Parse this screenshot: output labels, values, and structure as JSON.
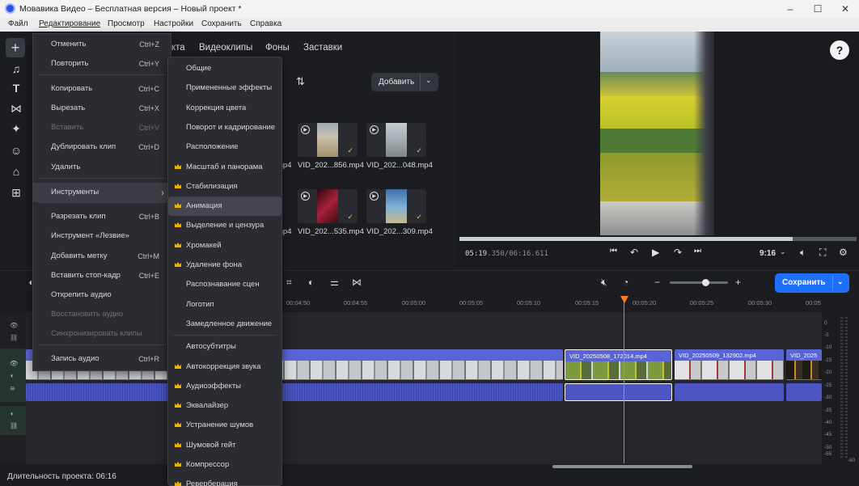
{
  "window": {
    "title": "Мовавика Видео – Бесплатная версия – Новый проект *",
    "minimize": "–",
    "maximize": "☐",
    "close": "✕"
  },
  "menubar": [
    "Файл",
    "Редактирование",
    "Просмотр",
    "Настройки",
    "Сохранить",
    "Справка"
  ],
  "library": {
    "tabs": [
      "Видеоклипы",
      "Фоны",
      "Заставки"
    ],
    "tab_partial": "кта",
    "add_label": "Добавить",
    "thumbs": [
      {
        "name": "VID_202...856.mp4",
        "color": "#a79a7c"
      },
      {
        "name": "VID_202...048.mp4",
        "color": "#8f9798"
      },
      {
        "name": "VID_202...535.mp4",
        "color": "#6a1a24"
      },
      {
        "name": "VID_202...309.mp4",
        "color": "#4a7fae"
      }
    ],
    "partial_names": [
      "mp4",
      "mp4"
    ]
  },
  "preview": {
    "help": "?",
    "timecode_current": "05:19",
    "timecode_ms": ".350",
    "timecode_total": "/06:16.611",
    "aspect": "9:16",
    "progress": 0.84
  },
  "toolbar": {
    "save_label": "Сохранить"
  },
  "ruler": [
    "00:04:50",
    "00:04:55",
    "00:05:00",
    "00:05:05",
    "00:05:10",
    "00:05:15",
    "00:05:20",
    "00:05:25",
    "00:05:30",
    "00:05"
  ],
  "clips": {
    "c1": "VID_20250508_172014.mp4",
    "c2": "VID_20250509_132902.mp4",
    "c3": "VID_2025"
  },
  "meter": [
    "0",
    "-5",
    "-10",
    "-15",
    "-20",
    "-25",
    "-30",
    "-35",
    "-40",
    "-45",
    "-50",
    "-55",
    "-60"
  ],
  "status": "Длительность проекта: 06:16",
  "edit_menu": [
    {
      "label": "Отменить",
      "shortcut": "Ctrl+Z",
      "disabled": false
    },
    {
      "label": "Повторить",
      "shortcut": "Ctrl+Y",
      "disabled": false
    },
    {
      "label": "Копировать",
      "shortcut": "Ctrl+C",
      "disabled": false
    },
    {
      "label": "Вырезать",
      "shortcut": "Ctrl+X",
      "disabled": false
    },
    {
      "label": "Вставить",
      "shortcut": "Ctrl+V",
      "disabled": true
    },
    {
      "label": "Дублировать клип",
      "shortcut": "Ctrl+D",
      "disabled": false
    },
    {
      "label": "Удалить",
      "shortcut": "",
      "disabled": false
    },
    {
      "label": "Инструменты",
      "shortcut": "›",
      "disabled": false
    },
    {
      "label": "Разрезать клип",
      "shortcut": "Ctrl+B",
      "disabled": false
    },
    {
      "label": "Инструмент «Лезвие»",
      "shortcut": "",
      "disabled": false
    },
    {
      "label": "Добавить метку",
      "shortcut": "Ctrl+M",
      "disabled": false
    },
    {
      "label": "Вставить стоп-кадр",
      "shortcut": "Ctrl+E",
      "disabled": false
    },
    {
      "label": "Открепить аудио",
      "shortcut": "",
      "disabled": false
    },
    {
      "label": "Восстановить аудио",
      "shortcut": "",
      "disabled": true
    },
    {
      "label": "Синхронизировать клипы",
      "shortcut": "",
      "disabled": true
    },
    {
      "label": "Запись аудио",
      "shortcut": "Ctrl+R",
      "disabled": false
    }
  ],
  "tools_menu": [
    {
      "label": "Общие",
      "premium": false
    },
    {
      "label": "Примененные эффекты",
      "premium": false
    },
    {
      "label": "Коррекция цвета",
      "premium": false
    },
    {
      "label": "Поворот и кадрирование",
      "premium": false
    },
    {
      "label": "Расположение",
      "premium": false
    },
    {
      "label": "Масштаб и панорама",
      "premium": true
    },
    {
      "label": "Стабилизация",
      "premium": true
    },
    {
      "label": "Анимация",
      "premium": true
    },
    {
      "label": "Выделение и цензура",
      "premium": true
    },
    {
      "label": "Хромакей",
      "premium": true
    },
    {
      "label": "Удаление фона",
      "premium": true
    },
    {
      "label": "Распознавание сцен",
      "premium": false
    },
    {
      "label": "Логотип",
      "premium": false
    },
    {
      "label": "Замедленное движение",
      "premium": false
    },
    {
      "label": "Автосубтитры",
      "premium": false
    },
    {
      "label": "Автокоррекция звука",
      "premium": true
    },
    {
      "label": "Аудиоэффекты",
      "premium": true
    },
    {
      "label": "Эквалайзер",
      "premium": true
    },
    {
      "label": "Устранение шумов",
      "premium": true
    },
    {
      "label": "Шумовой гейт",
      "premium": true
    },
    {
      "label": "Компрессор",
      "premium": true
    },
    {
      "label": "Реверберация",
      "premium": true
    }
  ]
}
